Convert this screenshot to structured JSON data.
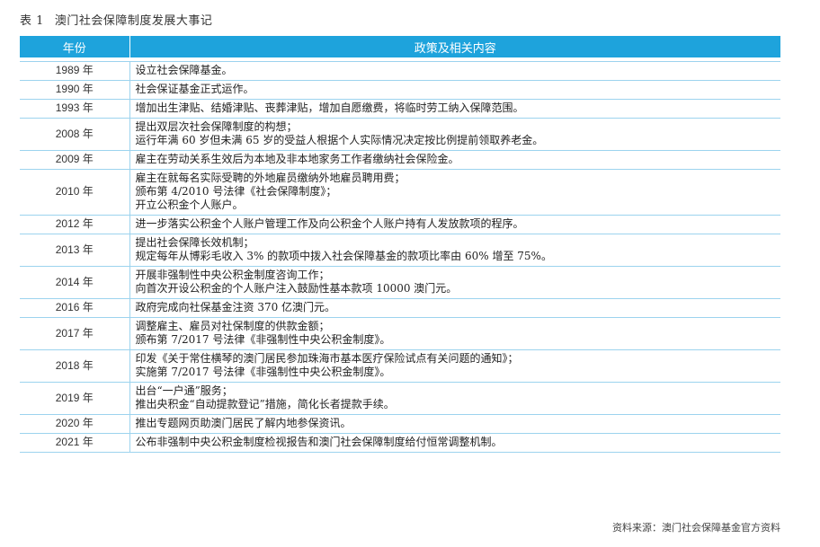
{
  "caption": {
    "number": "表 1",
    "title": "澳门社会保障制度发展大事记"
  },
  "header": {
    "year": "年份",
    "content": "政策及相关内容"
  },
  "rows": [
    {
      "year": "1989 年",
      "lines": [
        "设立社会保障基金。"
      ]
    },
    {
      "year": "1990 年",
      "lines": [
        "社会保证基金正式运作。"
      ]
    },
    {
      "year": "1993 年",
      "lines": [
        "增加出生津贴、结婚津贴、丧葬津贴，增加自愿缴费，将临时劳工纳入保障范围。"
      ]
    },
    {
      "year": "2008 年",
      "lines": [
        "提出双层次社会保障制度的构想；",
        "运行年满 60 岁但未满 65 岁的受益人根据个人实际情况决定按比例提前领取养老金。"
      ]
    },
    {
      "year": "2009 年",
      "lines": [
        "雇主在劳动关系生效后为本地及非本地家务工作者缴纳社会保险金。"
      ]
    },
    {
      "year": "2010 年",
      "lines": [
        "雇主在就每名实际受聘的外地雇员缴纳外地雇员聘用费；",
        "颁布第 4/2010 号法律《社会保障制度》；",
        "开立公积金个人账户。"
      ]
    },
    {
      "year": "2012 年",
      "lines": [
        "进一步落实公积金个人账户管理工作及向公积金个人账户持有人发放款项的程序。"
      ]
    },
    {
      "year": "2013 年",
      "lines": [
        "提出社会保障长效机制；",
        "规定每年从博彩毛收入 3% 的款项中拨入社会保障基金的款项比率由 60% 增至 75%。"
      ]
    },
    {
      "year": "2014 年",
      "lines": [
        "开展非强制性中央公积金制度咨询工作；",
        "向首次开设公积金的个人账户注入鼓励性基本款项 10000 澳门元。"
      ]
    },
    {
      "year": "2016 年",
      "lines": [
        "政府完成向社保基金注资 370 亿澳门元。"
      ]
    },
    {
      "year": "2017 年",
      "lines": [
        "调整雇主、雇员对社保制度的供款金额；",
        "颁布第 7/2017 号法律《非强制性中央公积金制度》。"
      ]
    },
    {
      "year": "2018 年",
      "lines": [
        "印发《关于常住横琴的澳门居民参加珠海市基本医疗保险试点有关问题的通知》；",
        "实施第 7/2017 号法律《非强制性中央公积金制度》。"
      ]
    },
    {
      "year": "2019 年",
      "lines": [
        "出台“一户通”服务；",
        "推出央积金“自动提款登记”措施，简化长者提款手续。"
      ]
    },
    {
      "year": "2020 年",
      "lines": [
        "推出专题网页助澳门居民了解内地参保资讯。"
      ]
    },
    {
      "year": "2021 年",
      "lines": [
        "公布非强制中央公积金制度检视报告和澳门社会保障制度给付恒常调整机制。"
      ]
    }
  ],
  "source": "资料来源：澳门社会保障基金官方资料",
  "colors": {
    "header_bg": "#1ea3dc",
    "rule": "#9cd3ee"
  }
}
